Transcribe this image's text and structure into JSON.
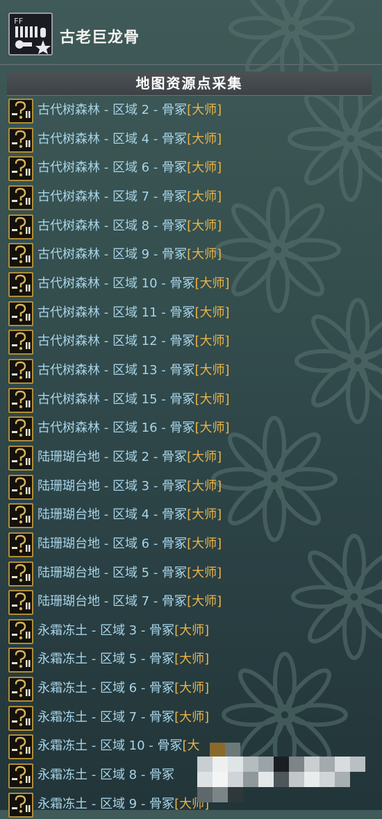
{
  "header": {
    "item_name": "古老巨龙骨",
    "icon_name": "dragon-bone-item-icon",
    "icon_badge": "FF"
  },
  "section": {
    "title": "地图资源点采集"
  },
  "rows": [
    {
      "location": "古代树森林 - 区域 2 - 骨冢",
      "tag": "[大师]"
    },
    {
      "location": "古代树森林 - 区域 4 - 骨冢",
      "tag": "[大师]"
    },
    {
      "location": "古代树森林 - 区域 6 - 骨冢",
      "tag": "[大师]"
    },
    {
      "location": "古代树森林 - 区域 7 - 骨冢",
      "tag": "[大师]"
    },
    {
      "location": "古代树森林 - 区域 8 - 骨冢",
      "tag": "[大师]"
    },
    {
      "location": "古代树森林 - 区域 9 - 骨冢",
      "tag": "[大师]"
    },
    {
      "location": "古代树森林 - 区域 10 - 骨冢",
      "tag": "[大师]"
    },
    {
      "location": "古代树森林 - 区域 11 - 骨冢",
      "tag": "[大师]"
    },
    {
      "location": "古代树森林 - 区域 12 - 骨冢",
      "tag": "[大师]"
    },
    {
      "location": "古代树森林 - 区域 13 - 骨冢",
      "tag": "[大师]"
    },
    {
      "location": "古代树森林 - 区域 15 - 骨冢",
      "tag": "[大师]"
    },
    {
      "location": "古代树森林 - 区域 16 - 骨冢",
      "tag": "[大师]"
    },
    {
      "location": "陆珊瑚台地 - 区域 2 - 骨冢",
      "tag": "[大师]"
    },
    {
      "location": "陆珊瑚台地 - 区域 3 - 骨冢",
      "tag": "[大师]"
    },
    {
      "location": "陆珊瑚台地 - 区域 4 - 骨冢",
      "tag": "[大师]"
    },
    {
      "location": "陆珊瑚台地 - 区域 6 - 骨冢",
      "tag": "[大师]"
    },
    {
      "location": "陆珊瑚台地 - 区域 5 - 骨冢",
      "tag": "[大师]"
    },
    {
      "location": "陆珊瑚台地 - 区域 7 - 骨冢",
      "tag": "[大师]"
    },
    {
      "location": "永霜冻土 - 区域 3 - 骨冢",
      "tag": "[大师]"
    },
    {
      "location": "永霜冻土 - 区域 5 - 骨冢",
      "tag": "[大师]"
    },
    {
      "location": "永霜冻土 - 区域 6 - 骨冢",
      "tag": "[大师]"
    },
    {
      "location": "永霜冻土 - 区域 7 - 骨冢",
      "tag": "[大师]"
    },
    {
      "location": "永霜冻土 - 区域 10 - 骨冢",
      "tag": "[大"
    },
    {
      "location": "永霜冻土 - 区域 8 - 骨冢",
      "tag": ""
    },
    {
      "location": "永霜冻土 - 区域 9 - 骨冢",
      "tag": "[大师]"
    }
  ],
  "row_icon_name": "unknown-resource-icon",
  "colors": {
    "location_text": "#a8d4e8",
    "tag_text": "#e8b44a",
    "background_top": "#3f5a58",
    "background_bottom": "#223539"
  }
}
